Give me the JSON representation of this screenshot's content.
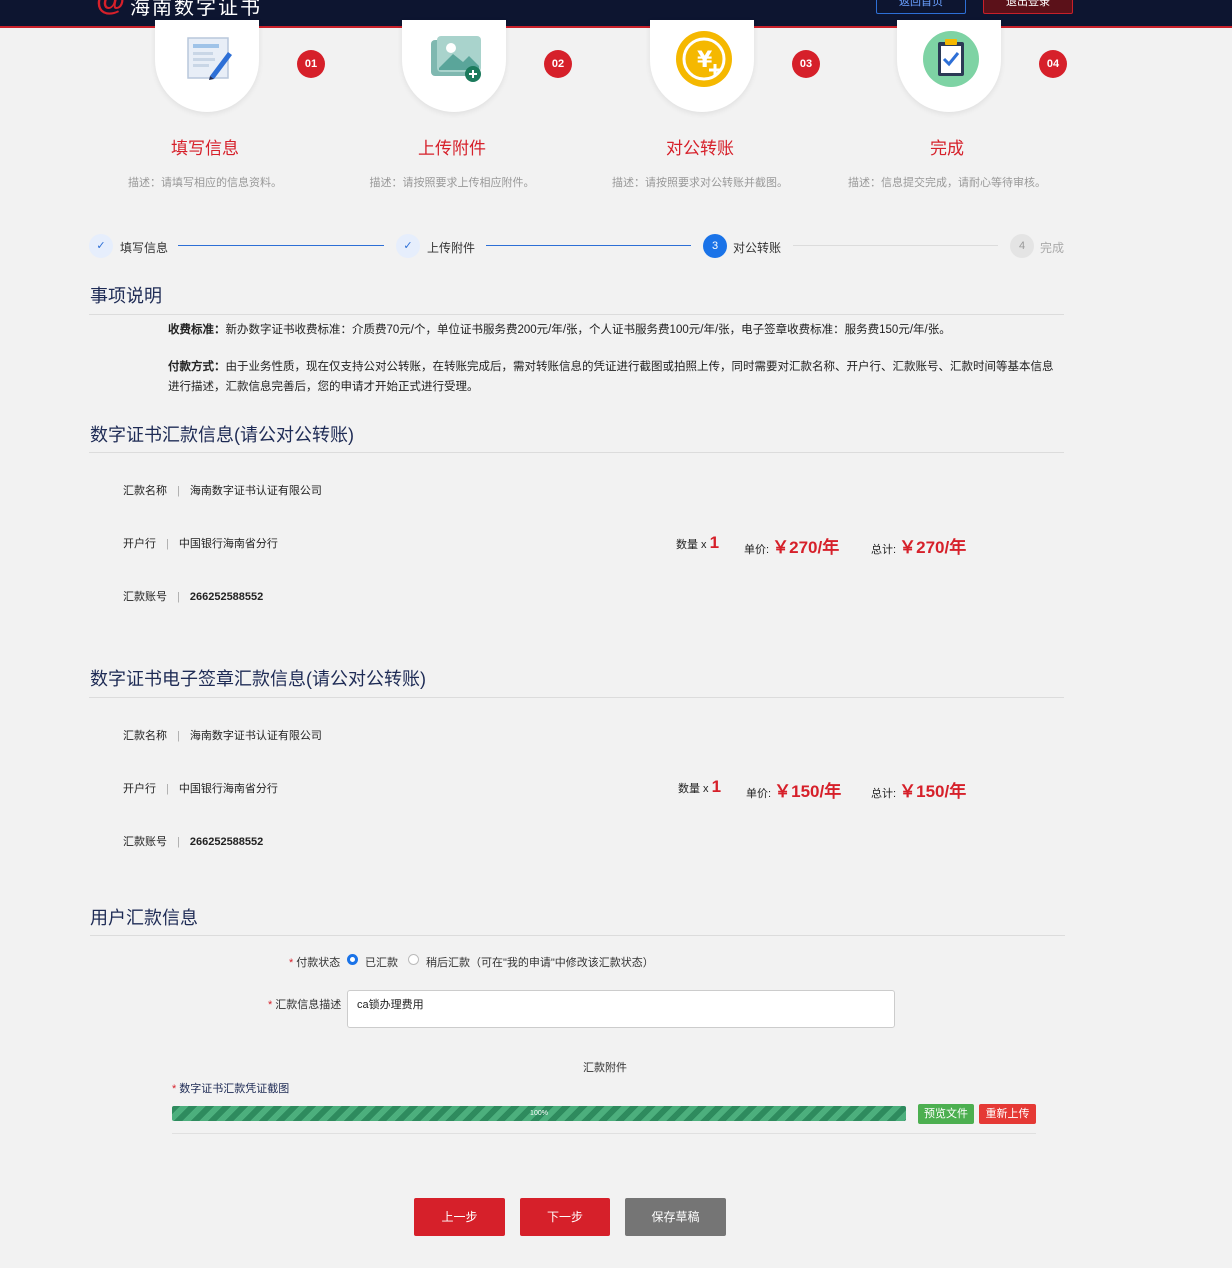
{
  "header": {
    "logo_mark": "@",
    "brand": "海南数字证书",
    "home_button": "返回首页",
    "logout_button": "退出登录"
  },
  "steps": [
    {
      "num": "01",
      "title": "填写信息",
      "desc": "描述：请填写相应的信息资料。",
      "icon": "form-pen-icon"
    },
    {
      "num": "02",
      "title": "上传附件",
      "desc": "描述：请按照要求上传相应附件。",
      "icon": "image-upload-icon"
    },
    {
      "num": "03",
      "title": "对公转账",
      "desc": "描述：请按照要求对公转账并截图。",
      "icon": "yuan-coin-icon"
    },
    {
      "num": "04",
      "title": "完成",
      "desc": "描述：信息提交完成，请耐心等待审核。",
      "icon": "clipboard-check-icon"
    }
  ],
  "progress_steps": [
    {
      "mark": "✓",
      "label": "填写信息",
      "state": "done"
    },
    {
      "mark": "✓",
      "label": "上传附件",
      "state": "done"
    },
    {
      "mark": "3",
      "label": "对公转账",
      "state": "active"
    },
    {
      "mark": "4",
      "label": "完成",
      "state": "todo"
    }
  ],
  "notice": {
    "title": "事项说明",
    "fee_label": "收费标准：",
    "fee_text": "新办数字证书收费标准：介质费70元/个，单位证书服务费200元/年/张，个人证书服务费100元/年/张，电子签章收费标准：服务费150元/年/张。",
    "pay_label": "付款方式：",
    "pay_text": "由于业务性质，现在仅支持公对公转账，在转账完成后，需对转账信息的凭证进行截图或拍照上传，同时需要对汇款名称、开户行、汇款账号、汇款时间等基本信息进行描述，汇款信息完善后，您的申请才开始正式进行受理。"
  },
  "remit1": {
    "title": "数字证书汇款信息(请公对公转账)",
    "name_label": "汇款名称",
    "name": "海南数字证书认证有限公司",
    "bank_label": "开户行",
    "bank": "中国银行海南省分行",
    "account_label": "汇款账号",
    "account": "266252588552",
    "qty_label": "数量 x",
    "qty": "1",
    "unit_label": "单价:",
    "unit_price": "￥270/年",
    "total_label": "总计:",
    "total": "￥270/年"
  },
  "remit2": {
    "title": "数字证书电子签章汇款信息(请公对公转账)",
    "name_label": "汇款名称",
    "name": "海南数字证书认证有限公司",
    "bank_label": "开户行",
    "bank": "中国银行海南省分行",
    "account_label": "汇款账号",
    "account": "266252588552",
    "qty_label": "数量 x",
    "qty": "1",
    "unit_label": "单价:",
    "unit_price": "￥150/年",
    "total_label": "总计:",
    "total": "￥150/年"
  },
  "user": {
    "title": "用户汇款信息",
    "req": "*",
    "status_label": "付款状态",
    "opt_paid": "已汇款",
    "opt_later": "稍后汇款（可在\"我的申请\"中修改该汇款状态）",
    "desc_label": "汇款信息描述",
    "desc_value": "ca锁办理费用",
    "attach_title": "汇款附件",
    "attach_label": "数字证书汇款凭证截图",
    "progress_text": "100%",
    "progress_value": 100,
    "preview_button": "预览文件",
    "reupload_button": "重新上传"
  },
  "actions": {
    "prev": "上一步",
    "next": "下一步",
    "draft": "保存草稿"
  },
  "colors": {
    "brand_red": "#d6202a",
    "header_bg": "#0d1530",
    "active_blue": "#1a73e8",
    "progress_green": "#2e8b5e"
  }
}
